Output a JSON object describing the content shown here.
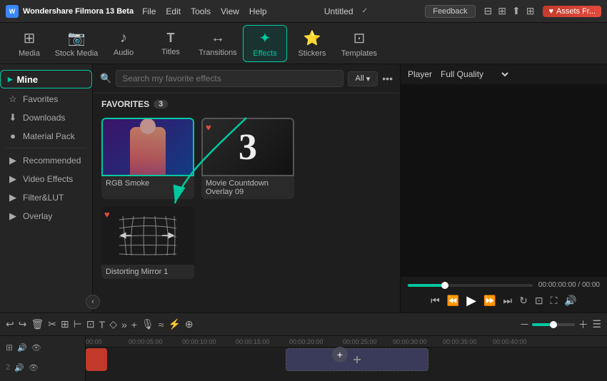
{
  "app": {
    "name": "Wondershare Filmora 13 Beta",
    "title": "Untitled",
    "feedback_label": "Feedback",
    "assets_label": "Assets Fr..."
  },
  "menu": {
    "items": [
      "File",
      "Edit",
      "Tools",
      "View",
      "Help"
    ]
  },
  "toolbar": {
    "items": [
      {
        "id": "media",
        "label": "Media",
        "icon": "⊞"
      },
      {
        "id": "stock-media",
        "label": "Stock Media",
        "icon": "🎬"
      },
      {
        "id": "audio",
        "label": "Audio",
        "icon": "♪"
      },
      {
        "id": "titles",
        "label": "Titles",
        "icon": "T"
      },
      {
        "id": "transitions",
        "label": "Transitions",
        "icon": "↔"
      },
      {
        "id": "effects",
        "label": "Effects",
        "icon": "✦"
      },
      {
        "id": "stickers",
        "label": "Stickers",
        "icon": "⭐"
      },
      {
        "id": "templates",
        "label": "Templates",
        "icon": "⊡"
      }
    ],
    "active": "effects"
  },
  "sidebar": {
    "mine_label": "Mine",
    "items": [
      {
        "id": "favorites",
        "label": "Favorites",
        "icon": "☆"
      },
      {
        "id": "downloads",
        "label": "Downloads",
        "icon": "⬇"
      },
      {
        "id": "material-pack",
        "label": "Material Pack",
        "icon": "●"
      },
      {
        "id": "recommended",
        "label": "Recommended",
        "icon": "▶"
      },
      {
        "id": "video-effects",
        "label": "Video Effects",
        "icon": "▶"
      },
      {
        "id": "filter-lut",
        "label": "Filter&LUT",
        "icon": "▶"
      },
      {
        "id": "overlay",
        "label": "Overlay",
        "icon": "▶"
      }
    ]
  },
  "effects_panel": {
    "search_placeholder": "Search my favorite effects",
    "filter_label": "All",
    "favorites_label": "FAVORITES",
    "favorites_count": "3",
    "cards": [
      {
        "id": "rgb-smoke",
        "label": "RGB Smoke",
        "has_heart": false,
        "active": true
      },
      {
        "id": "movie-countdown",
        "label": "Movie Countdown Overlay 09",
        "has_heart": true,
        "active": false
      },
      {
        "id": "distorting-mirror",
        "label": "Distorting Mirror 1",
        "has_heart": true,
        "active": false
      }
    ]
  },
  "player": {
    "label": "Player",
    "quality": "Full Quality",
    "time_current": "00:00:00:00",
    "time_total": "00:00",
    "progress_percent": 30
  },
  "timeline": {
    "tracks": [
      {
        "id": "track1",
        "icon": "🔊",
        "label": ""
      },
      {
        "id": "track2",
        "icon": "👁",
        "label": ""
      }
    ],
    "time_markers": [
      "00:00",
      "00:00:05:00",
      "00:00:10:00",
      "00:00:15:00",
      "00:00:20:00",
      "00:00:25:00",
      "00:00:30:00",
      "00:00:35:00",
      "00:00:40:00"
    ]
  }
}
